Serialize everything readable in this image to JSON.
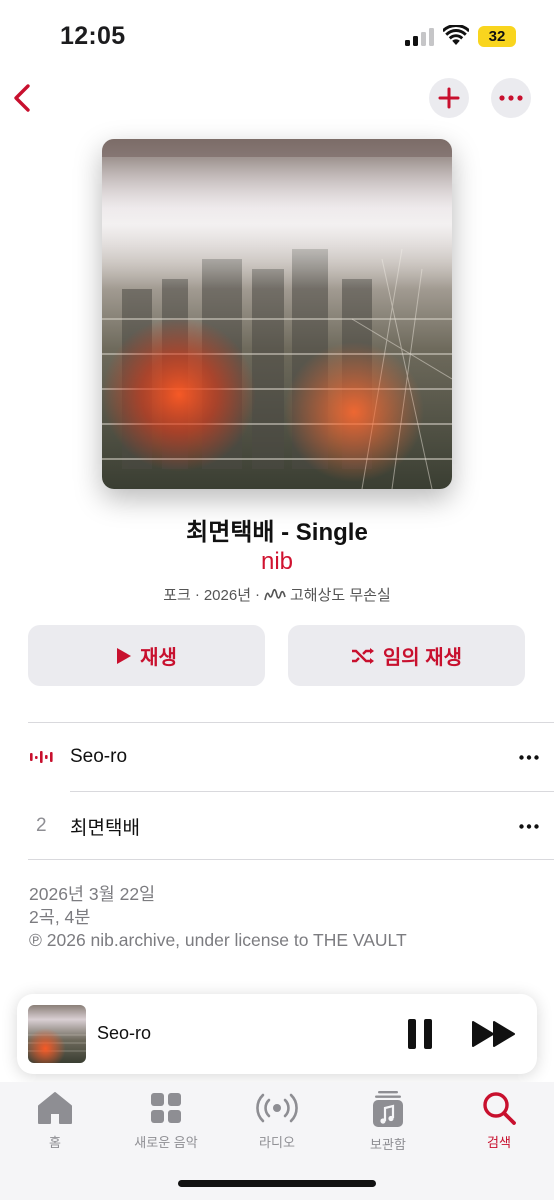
{
  "status_bar": {
    "time": "12:05",
    "battery": "32"
  },
  "album": {
    "title": "최면택배 - Single",
    "artist": "nib",
    "genre": "포크",
    "year": "2026년",
    "quality": "고해상도 무손실"
  },
  "actions": {
    "play_label": "재생",
    "shuffle_label": "임의 재생"
  },
  "tracks": [
    {
      "number": "",
      "title": "Seo-ro",
      "playing": true
    },
    {
      "number": "2",
      "title": "최면택배",
      "playing": false
    }
  ],
  "footer": {
    "release_date": "2026년 3월 22일",
    "summary": "2곡, 4분",
    "copyright": "℗ 2026 nib.archive, under license to THE VAULT"
  },
  "mini_player": {
    "title": "Seo-ro"
  },
  "tab_bar": {
    "items": [
      {
        "label": "홈",
        "icon": "home-icon"
      },
      {
        "label": "새로운 음악",
        "icon": "grid-icon"
      },
      {
        "label": "라디오",
        "icon": "radio-icon"
      },
      {
        "label": "보관함",
        "icon": "library-icon"
      },
      {
        "label": "검색",
        "icon": "search-icon",
        "active": true
      }
    ]
  },
  "colors": {
    "accent": "#c8102e",
    "battery": "#f9d51e",
    "button_bg": "#ebebef"
  }
}
